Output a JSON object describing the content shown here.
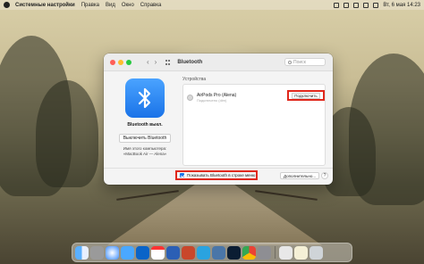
{
  "menubar": {
    "app_name": "Системные настройки",
    "items": [
      "Правка",
      "Вид",
      "Окно",
      "Справка"
    ],
    "clock": "Вт, 6 мая 14:23"
  },
  "window": {
    "title": "Bluetooth",
    "search_placeholder": "Поиск"
  },
  "bluetooth": {
    "status": "Bluetooth выкл.",
    "toggle_label": "Выключить Bluetooth",
    "computer_name_label": "Имя этого компьютера:",
    "computer_name": "«MacBook Air — Alena»"
  },
  "devices": {
    "section_label": "Устройства",
    "items": [
      {
        "name": "AirPods Pro (Alena)",
        "status": "Подключено (dim)",
        "action_label": "Подключить"
      }
    ]
  },
  "footer": {
    "show_in_menubar_label": "Показывать Bluetooth в строке меню",
    "show_in_menubar_checked": true,
    "advanced_label": "Дополнительно...",
    "help_label": "?"
  },
  "dock": {
    "apps": [
      "finder",
      "launchpad",
      "safari",
      "mail",
      "outlook",
      "calendar",
      "word",
      "powerpoint",
      "telegram",
      "vk",
      "photoshop",
      "chrome",
      "system-preferences",
      "preview",
      "notes",
      "trash"
    ]
  }
}
